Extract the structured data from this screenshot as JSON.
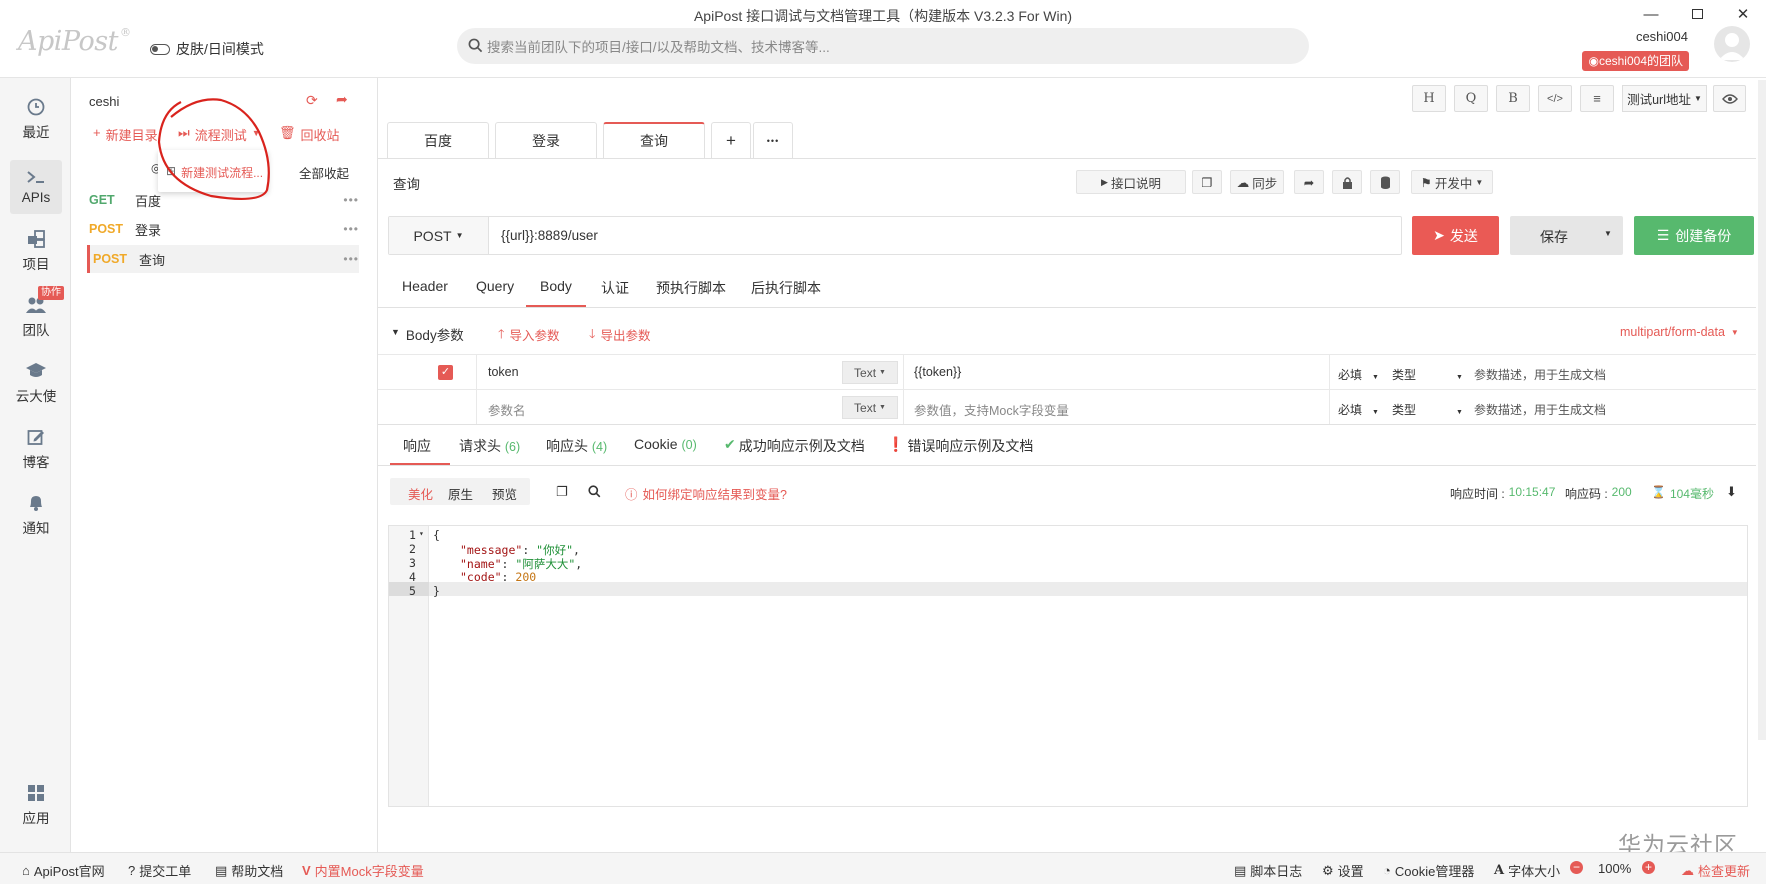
{
  "window": {
    "title": "ApiPost 接口调试与文档管理工具（构建版本 V3.2.3 For Win)"
  },
  "header": {
    "logo": "ApiPost",
    "logo_mark": "®",
    "skin_toggle": "皮肤/日间模式",
    "search_placeholder": "搜索当前团队下的项目/接口/以及帮助文档、技术博客等...",
    "username": "ceshi004",
    "team_badge": "ceshi004的团队"
  },
  "leftnav": {
    "items": [
      {
        "label": "最近",
        "icon": "clock-icon"
      },
      {
        "label": "APIs",
        "icon": "terminal-icon"
      },
      {
        "label": "项目",
        "icon": "project-icon"
      },
      {
        "label": "团队",
        "icon": "team-icon",
        "badge": "协作"
      },
      {
        "label": "云大使",
        "icon": "graduation-cap-icon"
      },
      {
        "label": "博客",
        "icon": "edit-icon"
      },
      {
        "label": "通知",
        "icon": "bell-icon"
      },
      {
        "label": "应用",
        "icon": "grid-icon"
      }
    ]
  },
  "tree": {
    "project_name": "ceshi",
    "new_dir": "新建目录",
    "flow_test": "流程测试",
    "recycle": "回收站",
    "locate": "定",
    "collapse_all": "全部收起",
    "dropdown_item": "新建测试流程...",
    "apis": [
      {
        "method": "GET",
        "name": "百度"
      },
      {
        "method": "POST",
        "name": "登录"
      },
      {
        "method": "POST",
        "name": "查询"
      }
    ]
  },
  "toolbar_right": {
    "buttons": [
      "H",
      "Q",
      "B",
      "</>",
      "≡"
    ],
    "env_select": "测试url地址"
  },
  "tabs": {
    "items": [
      "百度",
      "登录",
      "查询"
    ],
    "active": "查询",
    "add": "+",
    "more": "•••"
  },
  "request": {
    "name": "查询",
    "doc_btn": "接口说明",
    "sync_btn": "同步",
    "status_select": "开发中",
    "method": "POST",
    "url": "{{url}}:8889/user",
    "send": "发送",
    "save": "保存",
    "backup": "创建备份"
  },
  "req_tabs": {
    "items": [
      "Header",
      "Query",
      "Body",
      "认证",
      "预执行脚本",
      "后执行脚本"
    ],
    "active": "Body"
  },
  "body": {
    "title": "Body参数",
    "import": "导入参数",
    "export": "导出参数",
    "content_type": "multipart/form-data",
    "rows": [
      {
        "name": "token",
        "type": "Text",
        "value": "{{token}}",
        "required": "必填",
        "ptype": "类型",
        "desc": "参数描述，用于生成文档",
        "checked": true
      },
      {
        "name": "参数名",
        "type": "Text",
        "value": "参数值，支持Mock字段变量",
        "required": "必填",
        "ptype": "类型",
        "desc": "参数描述，用于生成文档",
        "checked": false
      }
    ]
  },
  "resp_tabs": {
    "response": "响应",
    "req_header": "请求头",
    "req_header_count": "(6)",
    "resp_header": "响应头",
    "resp_header_count": "(4)",
    "cookie": "Cookie",
    "cookie_count": "(0)",
    "success_doc": "成功响应示例及文档",
    "error_doc": "错误响应示例及文档"
  },
  "resp_view": {
    "modes": [
      "美化",
      "原生",
      "预览"
    ],
    "help_link": "如何绑定响应结果到变量?",
    "time_label": "响应时间 :",
    "time": "10:15:47",
    "code_label": "响应码 :",
    "code": "200",
    "duration": "104毫秒"
  },
  "response_lines": [
    {
      "n": "1",
      "fold": "▾",
      "text": "{"
    },
    {
      "n": "2",
      "key": "\"message\"",
      "sep": ": ",
      "val": "\"你好\"",
      "end": ","
    },
    {
      "n": "3",
      "key": "\"name\"",
      "sep": ": ",
      "val": "\"阿萨大大\"",
      "end": ","
    },
    {
      "n": "4",
      "key": "\"code\"",
      "sep": ": ",
      "num": "200",
      "end": ""
    },
    {
      "n": "5",
      "text": "}"
    }
  ],
  "watermark": "华为云社区",
  "footer": {
    "site": "ApiPost官网",
    "ticket": "提交工单",
    "help": "帮助文档",
    "mock": "内置Mock字段变量",
    "script_log": "脚本日志",
    "settings": "设置",
    "cookie_mgr": "Cookie管理器",
    "font_size": "字体大小",
    "zoom": "100%",
    "update": "检查更新"
  },
  "colors": {
    "accent": "#e55a55",
    "green": "#51a86d",
    "orange": "#f0a929",
    "annotation": "#d9231d"
  }
}
